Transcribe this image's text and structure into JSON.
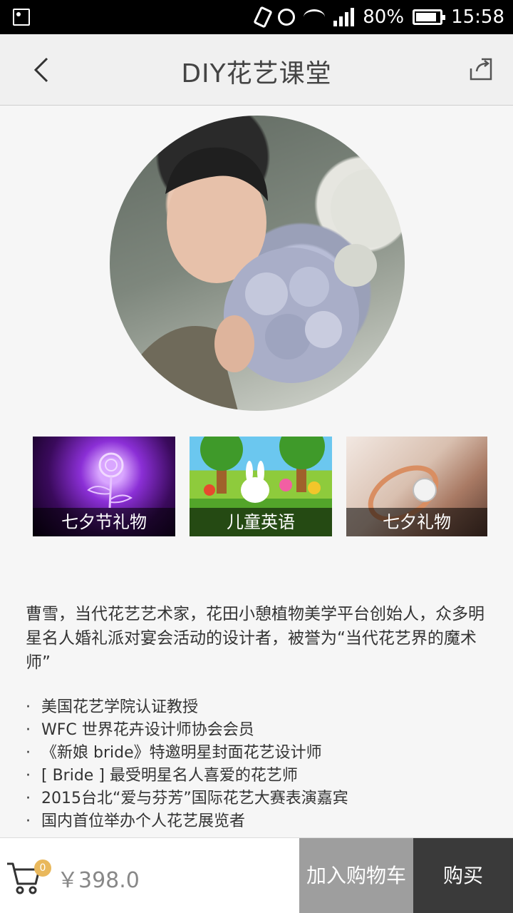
{
  "status_bar": {
    "battery_percent": "80%",
    "time": "15:58",
    "icons": [
      "image-icon",
      "vibrate-icon",
      "alarm-icon",
      "wifi-icon",
      "signal-icon",
      "battery-icon"
    ]
  },
  "header": {
    "title": "DIY花艺课堂",
    "back_icon": "chevron-left-icon",
    "share_icon": "share-icon"
  },
  "categories": [
    {
      "label": "七夕节礼物"
    },
    {
      "label": "儿童英语"
    },
    {
      "label": "七夕礼物"
    }
  ],
  "description": "曹雪，当代花艺艺术家，花田小憩植物美学平台创始人，众多明星名人婚礼派对宴会活动的设计者，被誉为“当代花艺界的魔术师”",
  "bullets": [
    {
      "dot": "·",
      "text": "美国花艺学院认证教授"
    },
    {
      "dot": "·",
      "text": "WFC 世界花卉设计师协会会员"
    },
    {
      "dot": "·",
      "text": "《新娘 bride》特邀明星封面花艺设计师"
    },
    {
      "dot": "·",
      "text": "[  Bride  ] 最受明星名人喜爱的花艺师"
    },
    {
      "dot": "·",
      "text": "2015台北“爱与芬芳”国际花艺大赛表演嘉宾"
    },
    {
      "dot": "·",
      "text": "国内首位举办个人花艺展览者"
    }
  ],
  "bottom_bar": {
    "cart_count": "0",
    "price": "￥398.0",
    "add_to_cart": "加入购物车",
    "buy": "购买"
  }
}
